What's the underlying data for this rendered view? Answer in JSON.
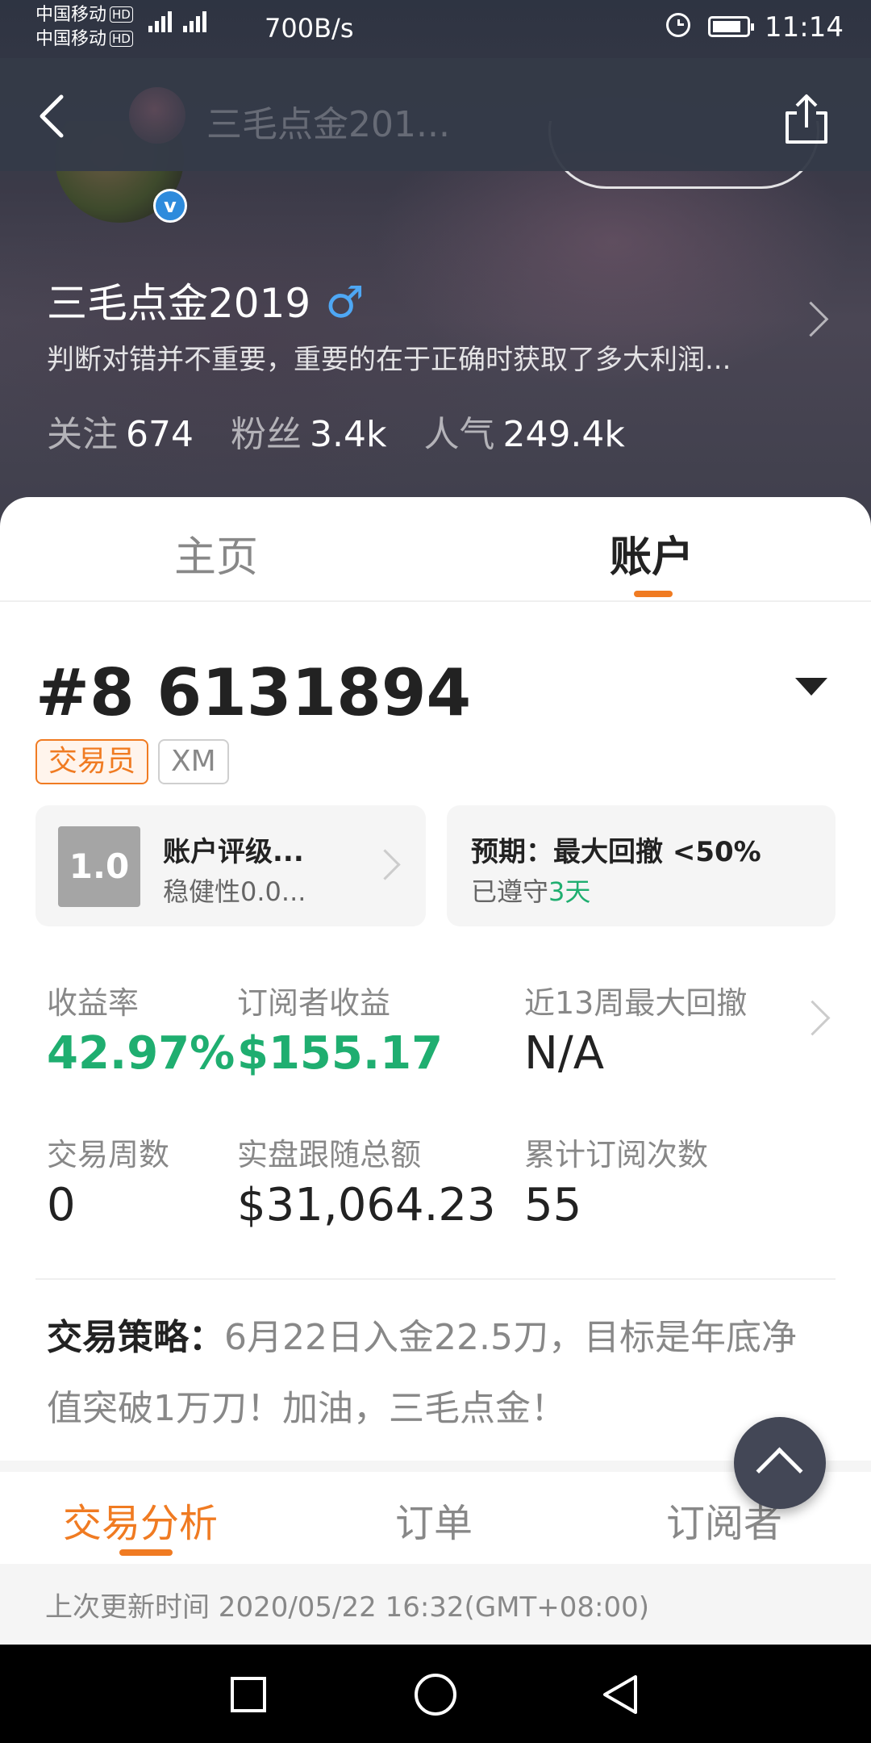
{
  "status_bar": {
    "carrier1": "中国移动",
    "carrier2": "中国移动",
    "hd": "HD",
    "network": "4G",
    "speed": "700B/s",
    "time": "11:14"
  },
  "nav": {
    "title": "三毛点金201..."
  },
  "profile": {
    "name": "三毛点金2019",
    "gender_symbol": "♂",
    "verified_mark": "v",
    "bio": "判断对错并不重要，重要的在于正确时获取了多大利润...",
    "stats": [
      {
        "label": "关注",
        "value": "674"
      },
      {
        "label": "粉丝",
        "value": "3.4k"
      },
      {
        "label": "人气",
        "value": "249.4k"
      }
    ]
  },
  "tabs": {
    "home": "主页",
    "account": "账户"
  },
  "account": {
    "id": "#8 6131894",
    "badge_role": "交易员",
    "badge_broker": "XM",
    "rating": {
      "score": "1.0",
      "title": "账户评级...",
      "sub": "稳健性0.0..."
    },
    "expectation": {
      "title": "预期：最大回撤 <50%",
      "kept_prefix": "已遵守",
      "kept_days": "3天"
    },
    "metrics": {
      "return_rate": {
        "label": "收益率",
        "value": "42.97%"
      },
      "subscriber_profit": {
        "label": "订阅者收益",
        "value": "$155.17"
      },
      "max_drawdown": {
        "label": "近13周最大回撤",
        "value": "N/A"
      },
      "trading_weeks": {
        "label": "交易周数",
        "value": "0"
      },
      "copy_total": {
        "label": "实盘跟随总额",
        "value": "$31,064.23"
      },
      "subscriptions": {
        "label": "累计订阅次数",
        "value": "55"
      }
    },
    "strategy": {
      "label": "交易策略：",
      "text": "6月22日入金22.5刀，目标是年底净值突破1万刀！加油，三毛点金！"
    }
  },
  "subtabs": {
    "analysis": "交易分析",
    "orders": "订单",
    "subscribers": "订阅者"
  },
  "update": {
    "text": "上次更新时间 2020/05/22 16:32(GMT+08:00)"
  },
  "colors": {
    "accent": "#f07b22",
    "positive": "#1fae70",
    "verified": "#2e8bdc",
    "gender": "#4ea7f4"
  }
}
